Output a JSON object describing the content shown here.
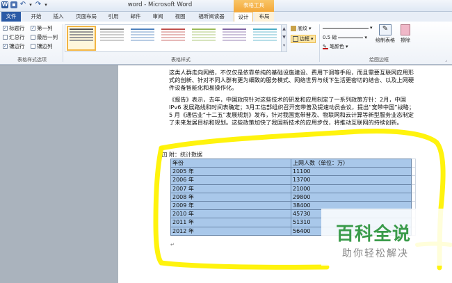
{
  "window": {
    "title": "word - Microsoft Word",
    "context_title": "表格工具"
  },
  "tabs": [
    {
      "label": "文件"
    },
    {
      "label": "开始"
    },
    {
      "label": "插入"
    },
    {
      "label": "页面布局"
    },
    {
      "label": "引用"
    },
    {
      "label": "邮件"
    },
    {
      "label": "审阅"
    },
    {
      "label": "视图"
    },
    {
      "label": "福昕阅读器"
    },
    {
      "label": "设计"
    },
    {
      "label": "布局"
    }
  ],
  "ribbon": {
    "style_options": {
      "header_row": "标题行",
      "first_column": "第一列",
      "total_row": "汇总行",
      "last_column": "最后一列",
      "banded_rows": "镶边行",
      "banded_columns": "镶边列",
      "group_label": "表格样式选项"
    },
    "table_styles": {
      "group_label": "表格样式",
      "shading": "底纹",
      "borders": "边框"
    },
    "draw_borders": {
      "pen_weight": "0.5 磅",
      "pen_color": "笔颜色",
      "draw_table": "绘制表格",
      "eraser": "擦除",
      "group_label": "绘图边框"
    }
  },
  "document": {
    "para1": "这类人群走向网络，不仅仅是依靠单纯的基础设施建设、费用下调等手段，而且需要互联网应用形式的创新、针对不同人群有更为细致的服务模式、网络世界与线下生活更密切的结合、以及上网硬件设备智能化和易操作化。",
    "para2": "《报告》表示，去年，中国政府针对这些技术的研发和应用制定了一系列政策方针：2月，中国 IPv6 发展路线和时间表确定；3月工信部组织召开宽带普及提速动员会议，提出“宽带中国”战略；5 月《通信业“十二五”发展规划》发布，针对我国宽带普及、物联网和云计算等新型服务业态制定了未来发展目标和规划。这些政策加快了我国新技术的应用步伐，将推动互联网的持续创新。",
    "caption": "附：统计数据",
    "table": {
      "header": [
        "年份",
        "上网人数（单位：万）"
      ],
      "rows": [
        [
          "2005 年",
          "11100"
        ],
        [
          "2006 年",
          "13700"
        ],
        [
          "2007 年",
          "21000"
        ],
        [
          "2008 年",
          "29800"
        ],
        [
          "2009 年",
          "38400"
        ],
        [
          "2010 年",
          "45730"
        ],
        [
          "2011 年",
          "51310"
        ],
        [
          "2012 年",
          "56400"
        ]
      ]
    }
  },
  "watermark": {
    "title": "百科全说",
    "subtitle": "助你轻松解决"
  },
  "colors": {
    "accent": "#2a5aa6",
    "table_fill": "#a9c8ea",
    "highlighter": "#fff200",
    "watermark_green": "#3a9b4a"
  }
}
